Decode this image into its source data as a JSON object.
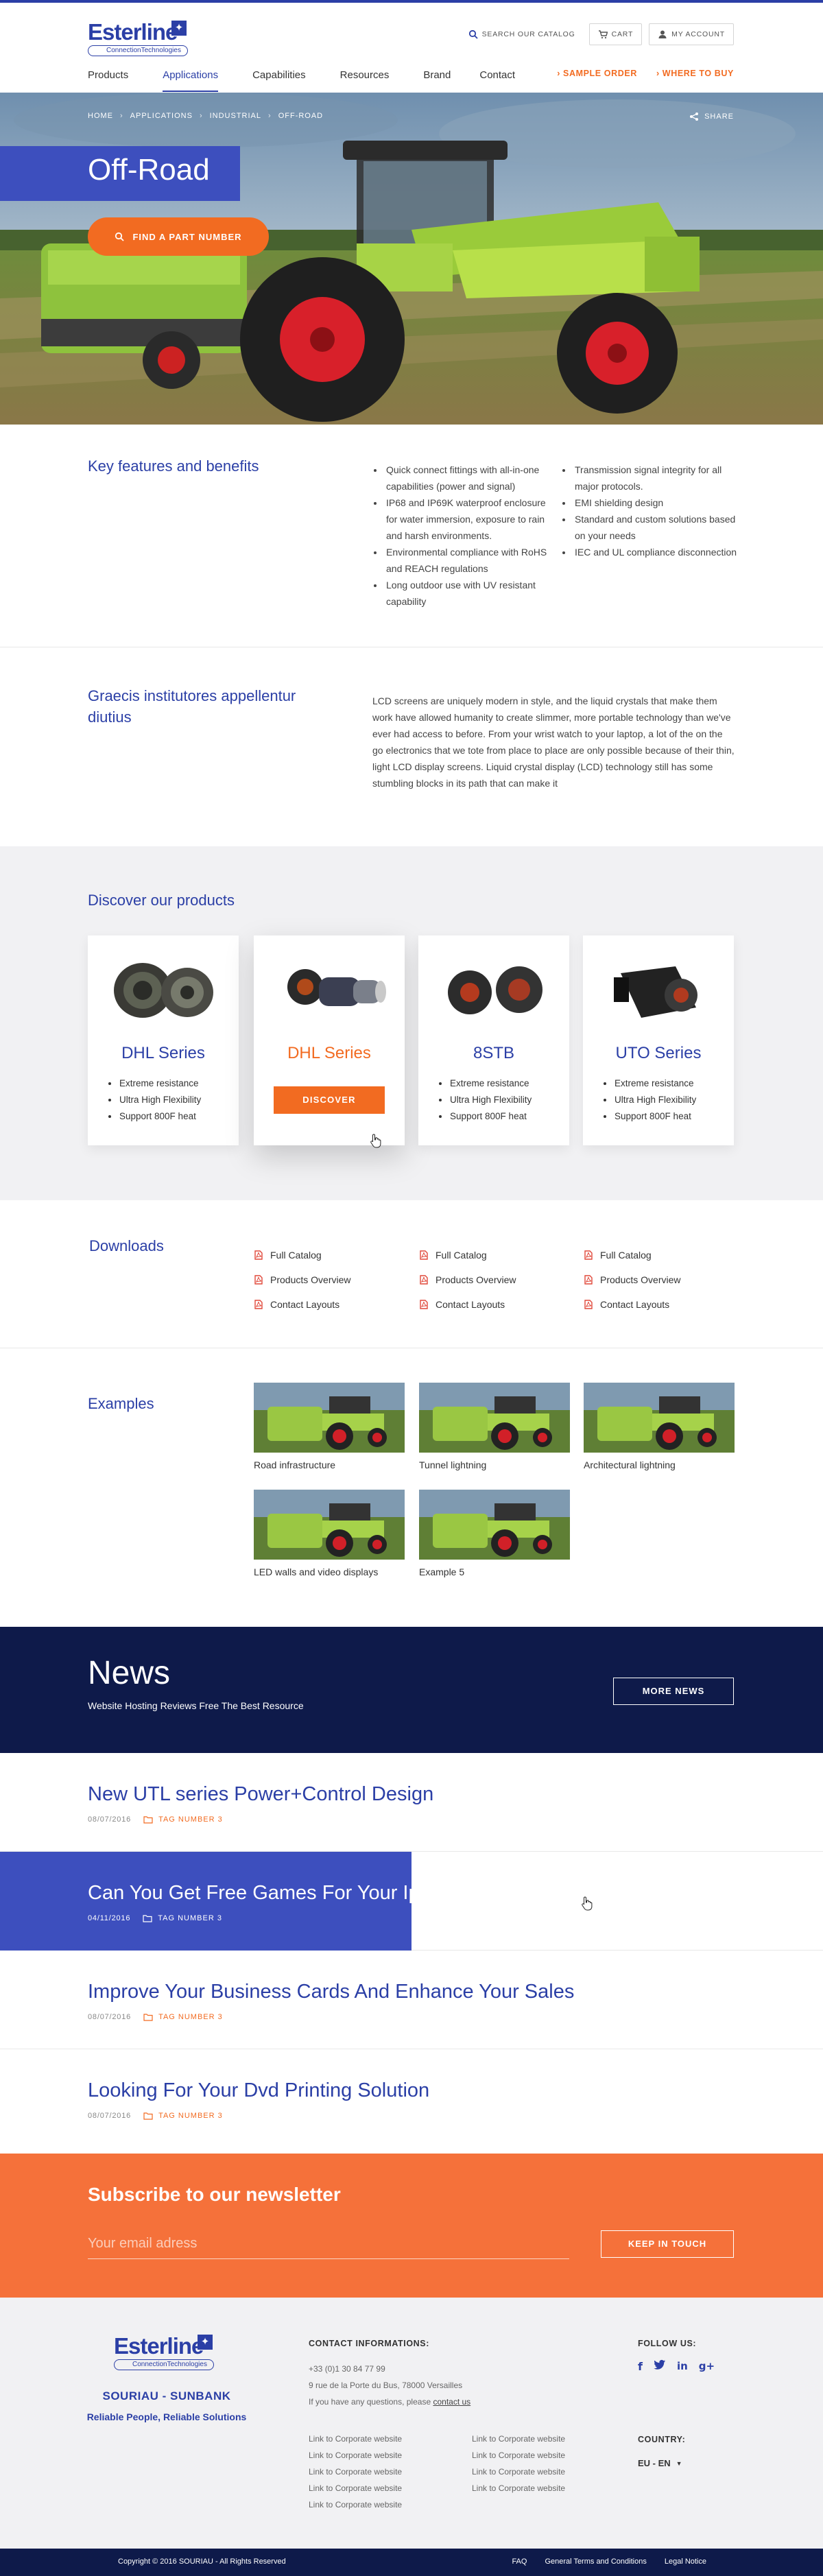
{
  "brand": {
    "logo_word": "Esterline",
    "logo_sub": "ConnectionTechnologies",
    "footer_brand": "SOURIAU - SUNBANK",
    "footer_tagline": "Reliable People, Reliable Solutions",
    "color_primary": "#2b3fa6",
    "color_accent": "#f26b21"
  },
  "header": {
    "search_label": "SEARCH OUR CATALOG",
    "cart_label": "CART",
    "account_label": "MY ACCOUNT",
    "nav": [
      "Products",
      "Applications",
      "Capabilities",
      "Resources",
      "Brand",
      "Contact"
    ],
    "active_nav": "Applications",
    "cta_sample": "SAMPLE ORDER",
    "cta_where": "WHERE TO BUY"
  },
  "hero": {
    "breadcrumb": [
      "HOME",
      "APPLICATIONS",
      "INDUSTRIAL",
      "OFF-ROAD"
    ],
    "share_label": "SHARE",
    "title": "Off-Road",
    "find_button": "FIND A PART NUMBER"
  },
  "features": {
    "title": "Key features and benefits",
    "col1": [
      "Quick connect fittings with all-in-one capabilities (power and signal)",
      "IP68 and IP69K waterproof enclosure for water immersion, exposure to rain and harsh environments.",
      "Environmental compliance with RoHS and REACH regulations",
      "Long outdoor use with UV resistant capability"
    ],
    "col2": [
      "Transmission signal integrity for all major protocols.",
      "EMI shielding design",
      "Standard and custom solutions based on your needs",
      "IEC and UL compliance disconnection"
    ]
  },
  "graecis": {
    "title": "Graecis institutores appellentur diutius",
    "body": "LCD screens are uniquely modern in style, and the liquid crystals that make them work have allowed humanity to create slimmer, more portable technology than we've ever had access to before. From your wrist watch to your laptop, a lot of the on the go electronics that we tote from place to place are only possible because of their thin, light LCD display screens. Liquid crystal display (LCD) technology still has some stumbling blocks in its path that can make it"
  },
  "products": {
    "title": "Discover our products",
    "discover_label": "DISCOVER",
    "items": [
      {
        "name": "DHL Series",
        "specs": [
          "Extreme resistance",
          "Ultra High Flexibility",
          "Support 800F heat"
        ]
      },
      {
        "name": "DHL Series",
        "specs": []
      },
      {
        "name": "8STB",
        "specs": [
          "Extreme resistance",
          "Ultra High Flexibility",
          "Support 800F heat"
        ]
      },
      {
        "name": "UTO Series",
        "specs": [
          "Extreme resistance",
          "Ultra High Flexibility",
          "Support 800F heat"
        ]
      }
    ]
  },
  "downloads": {
    "title": "Downloads",
    "columns": [
      [
        "Full Catalog",
        "Products Overview",
        "Contact Layouts"
      ],
      [
        "Full Catalog",
        "Products Overview",
        "Contact Layouts"
      ],
      [
        "Full Catalog",
        "Products Overview",
        "Contact Layouts"
      ]
    ]
  },
  "examples": {
    "title": "Examples",
    "items": [
      "Road infrastructure",
      "Tunnel lightning",
      "Architectural lightning",
      "LED walls and video displays",
      "Example 5"
    ]
  },
  "news": {
    "title": "News",
    "subtitle": "Website Hosting Reviews Free The Best Resource",
    "more_button": "MORE NEWS",
    "items": [
      {
        "title": "New UTL series Power+Control Design",
        "date": "08/07/2016",
        "tag": "TAG NUMBER 3"
      },
      {
        "title": "Can You Get Free Games For Your Iphone",
        "date": "04/11/2016",
        "tag": "TAG NUMBER 3"
      },
      {
        "title": "Improve Your Business Cards And Enhance Your Sales",
        "date": "08/07/2016",
        "tag": "TAG NUMBER 3"
      },
      {
        "title": "Looking For Your Dvd Printing Solution",
        "date": "08/07/2016",
        "tag": "TAG NUMBER 3"
      }
    ]
  },
  "subscribe": {
    "title": "Subscribe to our newsletter",
    "placeholder": "Your email adress",
    "button": "KEEP IN TOUCH"
  },
  "footer": {
    "contact_head": "CONTACT INFORMATIONS:",
    "phone": "+33 (0)1 30 84 77 99",
    "address": "9 rue de la Porte du Bus, 78000 Versailles",
    "question_prefix": "If you have any questions, please",
    "contact_link": "contact us",
    "links_col1": [
      "Link to Corporate website",
      "Link to Corporate website",
      "Link to Corporate website",
      "Link to Corporate website",
      "Link to Corporate website"
    ],
    "links_col2": [
      "Link to Corporate website",
      "Link to Corporate website",
      "Link to Corporate website",
      "Link to Corporate website"
    ],
    "follow_head": "FOLLOW US:",
    "social": [
      "f",
      "twitter",
      "in",
      "g+"
    ],
    "country_head": "COUNTRY:",
    "country_value": "EU - EN",
    "copyright": "Copyright © 2016 SOURIAU - All Rights Reserved",
    "legal": [
      "FAQ",
      "General Terms and Conditions",
      "Legal Notice"
    ]
  }
}
